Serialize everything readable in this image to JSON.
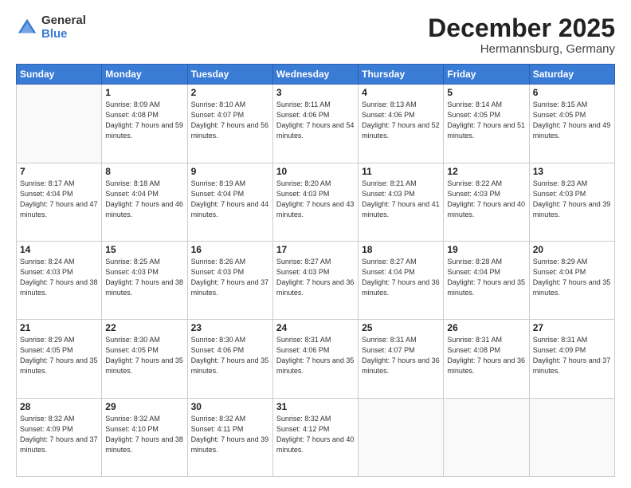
{
  "logo": {
    "general": "General",
    "blue": "Blue"
  },
  "header": {
    "title": "December 2025",
    "subtitle": "Hermannsburg, Germany"
  },
  "weekdays": [
    "Sunday",
    "Monday",
    "Tuesday",
    "Wednesday",
    "Thursday",
    "Friday",
    "Saturday"
  ],
  "weeks": [
    [
      {
        "day": "",
        "sunrise": "",
        "sunset": "",
        "daylight": ""
      },
      {
        "day": "1",
        "sunrise": "Sunrise: 8:09 AM",
        "sunset": "Sunset: 4:08 PM",
        "daylight": "Daylight: 7 hours and 59 minutes."
      },
      {
        "day": "2",
        "sunrise": "Sunrise: 8:10 AM",
        "sunset": "Sunset: 4:07 PM",
        "daylight": "Daylight: 7 hours and 56 minutes."
      },
      {
        "day": "3",
        "sunrise": "Sunrise: 8:11 AM",
        "sunset": "Sunset: 4:06 PM",
        "daylight": "Daylight: 7 hours and 54 minutes."
      },
      {
        "day": "4",
        "sunrise": "Sunrise: 8:13 AM",
        "sunset": "Sunset: 4:06 PM",
        "daylight": "Daylight: 7 hours and 52 minutes."
      },
      {
        "day": "5",
        "sunrise": "Sunrise: 8:14 AM",
        "sunset": "Sunset: 4:05 PM",
        "daylight": "Daylight: 7 hours and 51 minutes."
      },
      {
        "day": "6",
        "sunrise": "Sunrise: 8:15 AM",
        "sunset": "Sunset: 4:05 PM",
        "daylight": "Daylight: 7 hours and 49 minutes."
      }
    ],
    [
      {
        "day": "7",
        "sunrise": "Sunrise: 8:17 AM",
        "sunset": "Sunset: 4:04 PM",
        "daylight": "Daylight: 7 hours and 47 minutes."
      },
      {
        "day": "8",
        "sunrise": "Sunrise: 8:18 AM",
        "sunset": "Sunset: 4:04 PM",
        "daylight": "Daylight: 7 hours and 46 minutes."
      },
      {
        "day": "9",
        "sunrise": "Sunrise: 8:19 AM",
        "sunset": "Sunset: 4:04 PM",
        "daylight": "Daylight: 7 hours and 44 minutes."
      },
      {
        "day": "10",
        "sunrise": "Sunrise: 8:20 AM",
        "sunset": "Sunset: 4:03 PM",
        "daylight": "Daylight: 7 hours and 43 minutes."
      },
      {
        "day": "11",
        "sunrise": "Sunrise: 8:21 AM",
        "sunset": "Sunset: 4:03 PM",
        "daylight": "Daylight: 7 hours and 41 minutes."
      },
      {
        "day": "12",
        "sunrise": "Sunrise: 8:22 AM",
        "sunset": "Sunset: 4:03 PM",
        "daylight": "Daylight: 7 hours and 40 minutes."
      },
      {
        "day": "13",
        "sunrise": "Sunrise: 8:23 AM",
        "sunset": "Sunset: 4:03 PM",
        "daylight": "Daylight: 7 hours and 39 minutes."
      }
    ],
    [
      {
        "day": "14",
        "sunrise": "Sunrise: 8:24 AM",
        "sunset": "Sunset: 4:03 PM",
        "daylight": "Daylight: 7 hours and 38 minutes."
      },
      {
        "day": "15",
        "sunrise": "Sunrise: 8:25 AM",
        "sunset": "Sunset: 4:03 PM",
        "daylight": "Daylight: 7 hours and 38 minutes."
      },
      {
        "day": "16",
        "sunrise": "Sunrise: 8:26 AM",
        "sunset": "Sunset: 4:03 PM",
        "daylight": "Daylight: 7 hours and 37 minutes."
      },
      {
        "day": "17",
        "sunrise": "Sunrise: 8:27 AM",
        "sunset": "Sunset: 4:03 PM",
        "daylight": "Daylight: 7 hours and 36 minutes."
      },
      {
        "day": "18",
        "sunrise": "Sunrise: 8:27 AM",
        "sunset": "Sunset: 4:04 PM",
        "daylight": "Daylight: 7 hours and 36 minutes."
      },
      {
        "day": "19",
        "sunrise": "Sunrise: 8:28 AM",
        "sunset": "Sunset: 4:04 PM",
        "daylight": "Daylight: 7 hours and 35 minutes."
      },
      {
        "day": "20",
        "sunrise": "Sunrise: 8:29 AM",
        "sunset": "Sunset: 4:04 PM",
        "daylight": "Daylight: 7 hours and 35 minutes."
      }
    ],
    [
      {
        "day": "21",
        "sunrise": "Sunrise: 8:29 AM",
        "sunset": "Sunset: 4:05 PM",
        "daylight": "Daylight: 7 hours and 35 minutes."
      },
      {
        "day": "22",
        "sunrise": "Sunrise: 8:30 AM",
        "sunset": "Sunset: 4:05 PM",
        "daylight": "Daylight: 7 hours and 35 minutes."
      },
      {
        "day": "23",
        "sunrise": "Sunrise: 8:30 AM",
        "sunset": "Sunset: 4:06 PM",
        "daylight": "Daylight: 7 hours and 35 minutes."
      },
      {
        "day": "24",
        "sunrise": "Sunrise: 8:31 AM",
        "sunset": "Sunset: 4:06 PM",
        "daylight": "Daylight: 7 hours and 35 minutes."
      },
      {
        "day": "25",
        "sunrise": "Sunrise: 8:31 AM",
        "sunset": "Sunset: 4:07 PM",
        "daylight": "Daylight: 7 hours and 36 minutes."
      },
      {
        "day": "26",
        "sunrise": "Sunrise: 8:31 AM",
        "sunset": "Sunset: 4:08 PM",
        "daylight": "Daylight: 7 hours and 36 minutes."
      },
      {
        "day": "27",
        "sunrise": "Sunrise: 8:31 AM",
        "sunset": "Sunset: 4:09 PM",
        "daylight": "Daylight: 7 hours and 37 minutes."
      }
    ],
    [
      {
        "day": "28",
        "sunrise": "Sunrise: 8:32 AM",
        "sunset": "Sunset: 4:09 PM",
        "daylight": "Daylight: 7 hours and 37 minutes."
      },
      {
        "day": "29",
        "sunrise": "Sunrise: 8:32 AM",
        "sunset": "Sunset: 4:10 PM",
        "daylight": "Daylight: 7 hours and 38 minutes."
      },
      {
        "day": "30",
        "sunrise": "Sunrise: 8:32 AM",
        "sunset": "Sunset: 4:11 PM",
        "daylight": "Daylight: 7 hours and 39 minutes."
      },
      {
        "day": "31",
        "sunrise": "Sunrise: 8:32 AM",
        "sunset": "Sunset: 4:12 PM",
        "daylight": "Daylight: 7 hours and 40 minutes."
      },
      {
        "day": "",
        "sunrise": "",
        "sunset": "",
        "daylight": ""
      },
      {
        "day": "",
        "sunrise": "",
        "sunset": "",
        "daylight": ""
      },
      {
        "day": "",
        "sunrise": "",
        "sunset": "",
        "daylight": ""
      }
    ]
  ]
}
